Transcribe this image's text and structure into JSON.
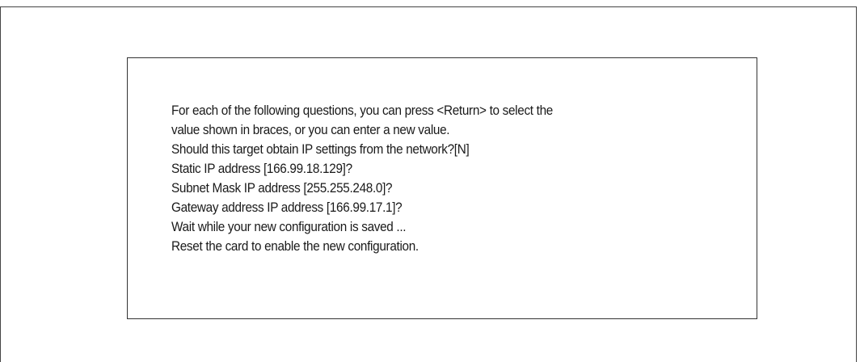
{
  "console": {
    "lines": [
      "For each of the following questions, you can press <Return> to select the",
      "value shown in braces, or you can enter a new value.",
      "Should this target obtain IP settings from the network?[N]",
      "Static IP address [166.99.18.129]?",
      "Subnet Mask IP address [255.255.248.0]?",
      "Gateway address IP address [166.99.17.1]?",
      "Wait while your new configuration is saved ...",
      "Reset the card to enable the new configuration."
    ]
  }
}
